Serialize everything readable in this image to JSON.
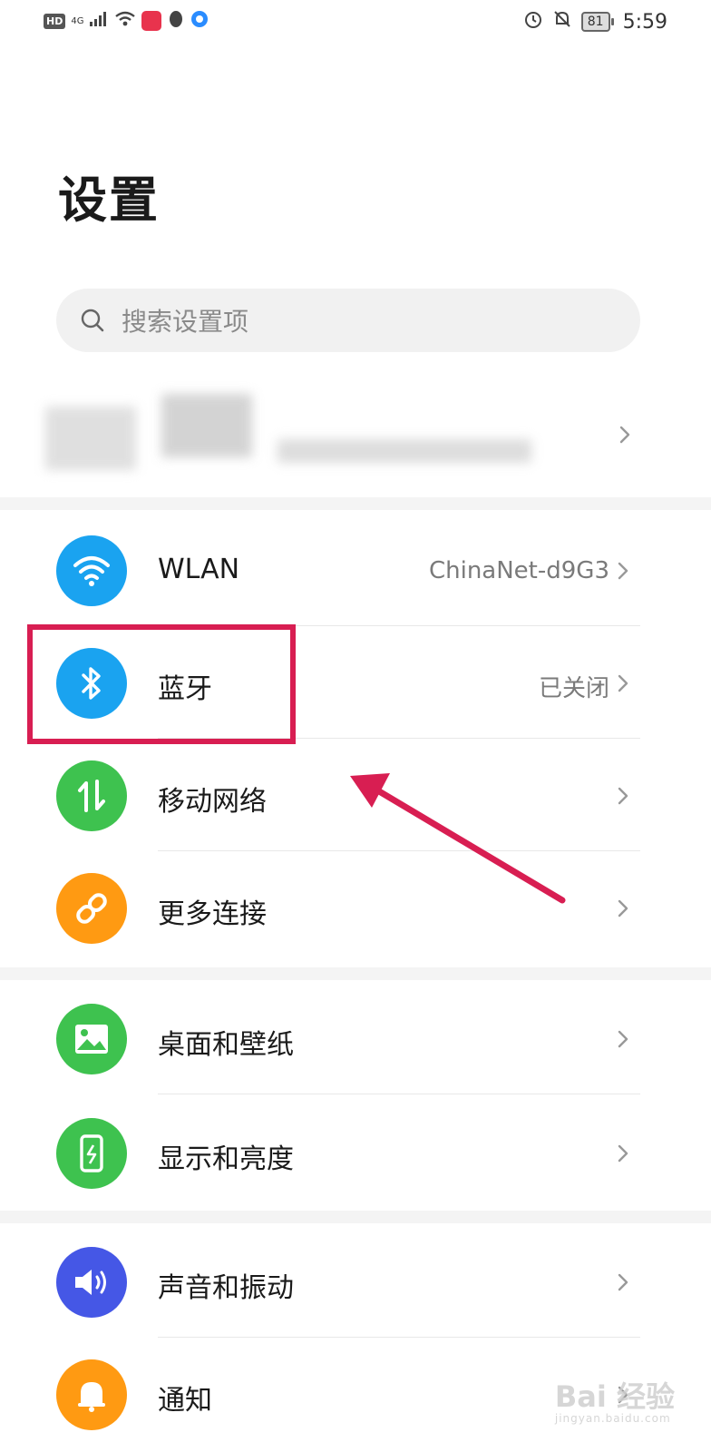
{
  "status_bar": {
    "left": {
      "hd": "HD",
      "net": "4G"
    },
    "right": {
      "battery": "81",
      "time": "5:59"
    }
  },
  "page": {
    "title": "设置"
  },
  "search": {
    "placeholder": "搜索设置项"
  },
  "sections": [
    {
      "items": [
        {
          "label": "WLAN",
          "value": "ChinaNet-d9G3",
          "icon": "wifi-icon",
          "color": "#1aa3f0"
        },
        {
          "label": "蓝牙",
          "value": "已关闭",
          "icon": "bluetooth-icon",
          "color": "#1aa3f0"
        },
        {
          "label": "移动网络",
          "value": "",
          "icon": "mobile-data-icon",
          "color": "#3ec24f"
        },
        {
          "label": "更多连接",
          "value": "",
          "icon": "link-icon",
          "color": "#ff9a12"
        }
      ]
    },
    {
      "items": [
        {
          "label": "桌面和壁纸",
          "value": "",
          "icon": "image-icon",
          "color": "#3ec24f"
        },
        {
          "label": "显示和亮度",
          "value": "",
          "icon": "phone-brightness-icon",
          "color": "#3ec24f"
        }
      ]
    },
    {
      "items": [
        {
          "label": "声音和振动",
          "value": "",
          "icon": "speaker-icon",
          "color": "#4557e6"
        },
        {
          "label": "通知",
          "value": "",
          "icon": "bell-icon",
          "color": "#ff9a12"
        }
      ]
    }
  ],
  "annotation": {
    "highlight_color": "#d81e52"
  },
  "watermark": {
    "text": "Bai 经验",
    "sub": "jingyan.baidu.com"
  }
}
